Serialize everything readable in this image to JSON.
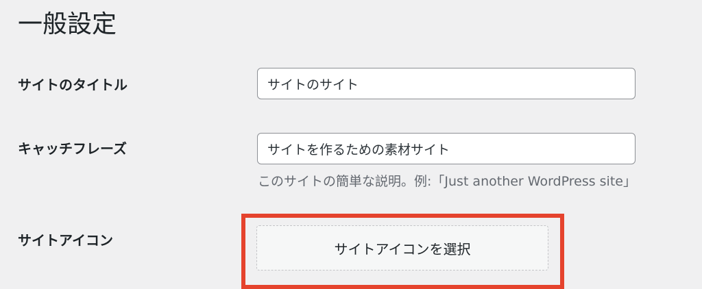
{
  "page": {
    "title": "一般設定"
  },
  "fields": {
    "site_title": {
      "label": "サイトのタイトル",
      "value": "サイトのサイト"
    },
    "tagline": {
      "label": "キャッチフレーズ",
      "value": "サイトを作るための素材サイト",
      "description": "このサイトの簡単な説明。例:「Just another WordPress site」"
    },
    "site_icon": {
      "label": "サイトアイコン",
      "button_label": "サイトアイコンを選択"
    }
  },
  "colors": {
    "highlight": "#e5432d",
    "background": "#f0f0f1"
  }
}
